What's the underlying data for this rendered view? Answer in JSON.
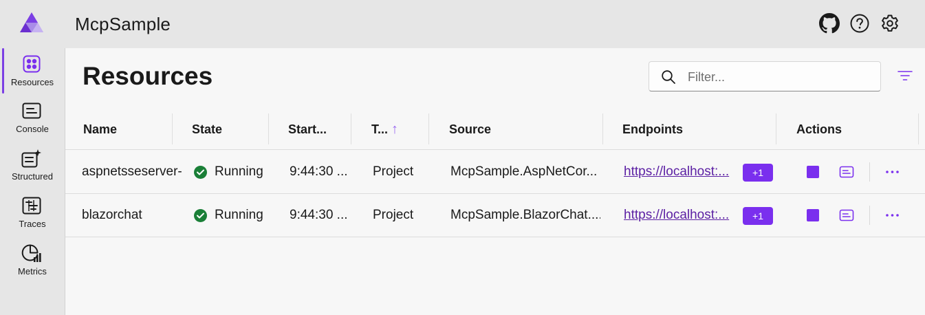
{
  "app": {
    "title": "McpSample"
  },
  "header_icons": [
    "github-icon",
    "help-icon",
    "settings-icon"
  ],
  "sidebar": {
    "items": [
      {
        "label": "Resources",
        "icon": "resources-grid-icon",
        "active": true
      },
      {
        "label": "Console",
        "icon": "console-icon",
        "active": false
      },
      {
        "label": "Structured",
        "icon": "structured-logs-icon",
        "active": false
      },
      {
        "label": "Traces",
        "icon": "traces-icon",
        "active": false
      },
      {
        "label": "Metrics",
        "icon": "metrics-icon",
        "active": false
      }
    ]
  },
  "page": {
    "title": "Resources",
    "filter_placeholder": "Filter...",
    "filter_value": ""
  },
  "table": {
    "columns": [
      "Name",
      "State",
      "Start...",
      "T...",
      "Source",
      "Endpoints",
      "Actions"
    ],
    "sort_indicator": "↑",
    "rows": [
      {
        "name": "aspnetsseserver-...",
        "state": "Running",
        "start": "9:44:30 ...",
        "type": "Project",
        "source": "McpSample.AspNetCor...",
        "endpoint": "https://localhost:...",
        "endpoint_more": "+1"
      },
      {
        "name": "blazorchat",
        "state": "Running",
        "start": "9:44:30 ...",
        "type": "Project",
        "source": "McpSample.BlazorChat....",
        "endpoint": "https://localhost:...",
        "endpoint_more": "+1"
      }
    ]
  },
  "colors": {
    "accent": "#7a2fee",
    "running": "#1a7f37",
    "link": "#5b1fa3",
    "header_bg": "#e6e6e6",
    "content_bg": "#f7f7f7"
  }
}
